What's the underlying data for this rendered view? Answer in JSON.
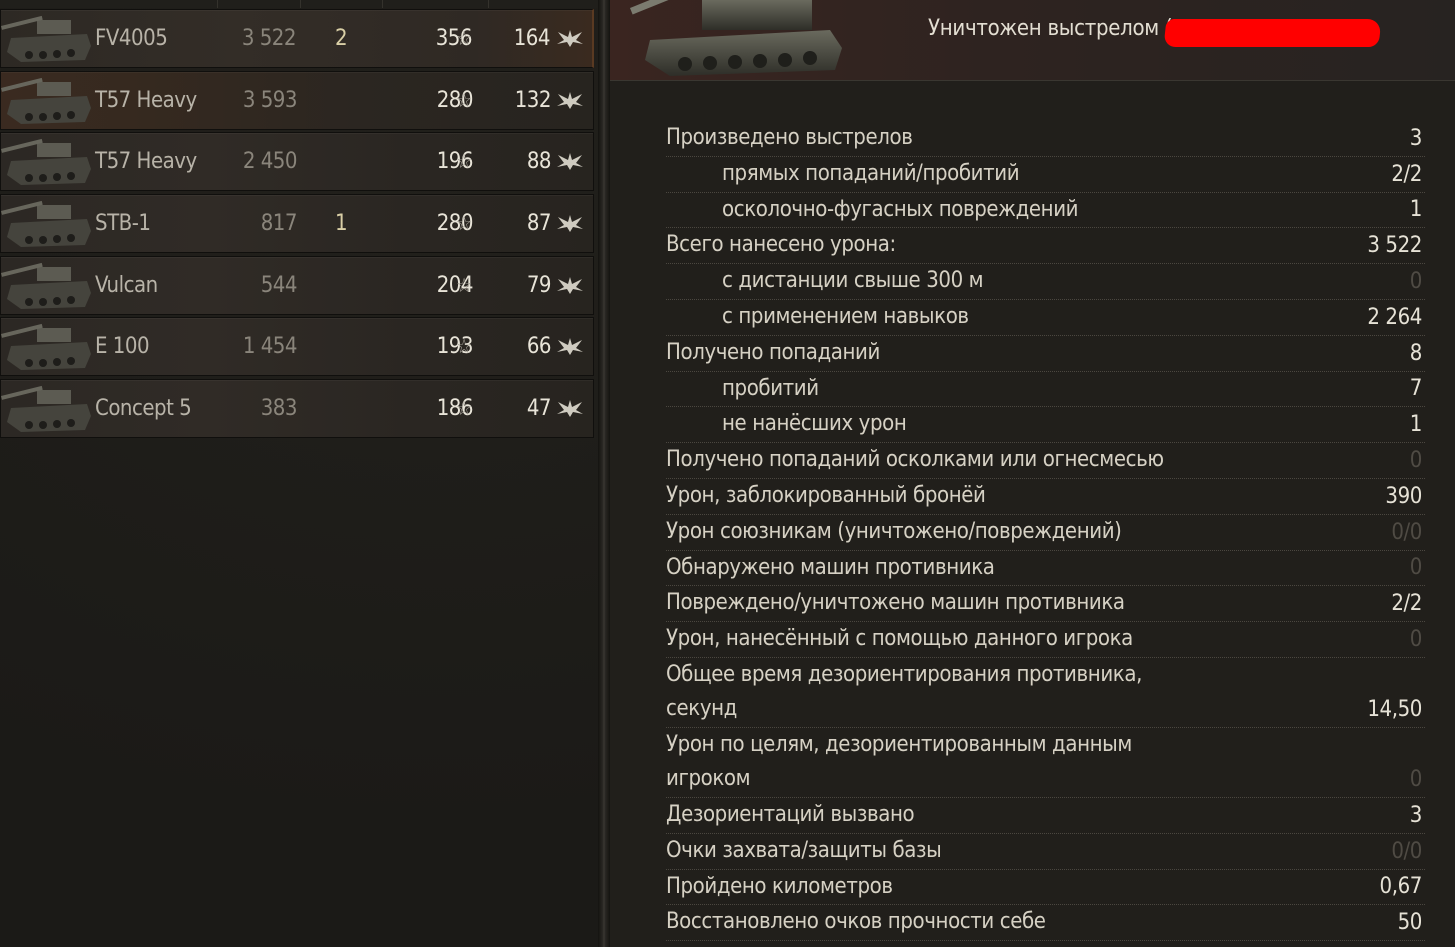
{
  "vehicles": [
    {
      "name": "FV4005",
      "exp": "3 522",
      "kills": "2",
      "damage": "356",
      "xp": "164",
      "highlight": "first"
    },
    {
      "name": "T57 Heavy",
      "exp": "3 593",
      "kills": "",
      "damage": "280",
      "xp": "132",
      "highlight": "hl"
    },
    {
      "name": "T57 Heavy",
      "exp": "2 450",
      "kills": "",
      "damage": "196",
      "xp": "88",
      "highlight": ""
    },
    {
      "name": "STB-1",
      "exp": "817",
      "kills": "1",
      "damage": "280",
      "xp": "87",
      "highlight": ""
    },
    {
      "name": "Vulcan",
      "exp": "544",
      "kills": "",
      "damage": "204",
      "xp": "79",
      "highlight": ""
    },
    {
      "name": "E 100",
      "exp": "1 454",
      "kills": "",
      "damage": "193",
      "xp": "66",
      "highlight": ""
    },
    {
      "name": "Concept 5",
      "exp": "383",
      "kills": "",
      "damage": "186",
      "xp": "47",
      "highlight": ""
    }
  ],
  "icons": {
    "star": "star-icon",
    "wing": "wings-icon",
    "tank": "tank-icon"
  },
  "detail": {
    "destroyed_label": "Уничтожен выстрелом (",
    "stats": [
      {
        "label": "Произведено выстрелов",
        "value": "3",
        "sub": false,
        "dim": false
      },
      {
        "label": "прямых попаданий/пробитий",
        "value": "2/2",
        "sub": true,
        "dim": false
      },
      {
        "label": "осколочно-фугасных повреждений",
        "value": "1",
        "sub": true,
        "dim": false
      },
      {
        "label": "Всего нанесено урона:",
        "value": "3 522",
        "sub": false,
        "dim": false
      },
      {
        "label": "с дистанции свыше 300 м",
        "value": "0",
        "sub": true,
        "dim": true
      },
      {
        "label": "с применением навыков",
        "value": "2 264",
        "sub": true,
        "dim": false
      },
      {
        "label": "Получено попаданий",
        "value": "8",
        "sub": false,
        "dim": false
      },
      {
        "label": "пробитий",
        "value": "7",
        "sub": true,
        "dim": false
      },
      {
        "label": "не нанёсших урон",
        "value": "1",
        "sub": true,
        "dim": false
      },
      {
        "label": "Получено попаданий осколками или огнесмесью",
        "value": "0",
        "sub": false,
        "dim": true
      },
      {
        "label": "Урон, заблокированный бронёй",
        "value": "390",
        "sub": false,
        "dim": false
      },
      {
        "label": "Урон союзникам (уничтожено/повреждений)",
        "value": "0/0",
        "sub": false,
        "dim": true
      },
      {
        "label": "Обнаружено машин противника",
        "value": "0",
        "sub": false,
        "dim": true
      },
      {
        "label": "Повреждено/уничтожено машин противника",
        "value": "2/2",
        "sub": false,
        "dim": false
      },
      {
        "label": "Урон, нанесённый с помощью данного игрока",
        "value": "0",
        "sub": false,
        "dim": true
      },
      {
        "label": "Общее время дезориентирования противника,\nсекунд",
        "value": "14,50",
        "sub": false,
        "dim": false,
        "tall": true
      },
      {
        "label": "Урон по целям, дезориентированным данным\nигроком",
        "value": "0",
        "sub": false,
        "dim": true,
        "tall": true
      },
      {
        "label": "Дезориентаций вызвано",
        "value": "3",
        "sub": false,
        "dim": false
      },
      {
        "label": "Очки захвата/защиты базы",
        "value": "0/0",
        "sub": false,
        "dim": true
      },
      {
        "label": "Пройдено километров",
        "value": "0,67",
        "sub": false,
        "dim": false
      },
      {
        "label": "Восстановлено очков прочности себе",
        "value": "50",
        "sub": false,
        "dim": false
      }
    ]
  }
}
